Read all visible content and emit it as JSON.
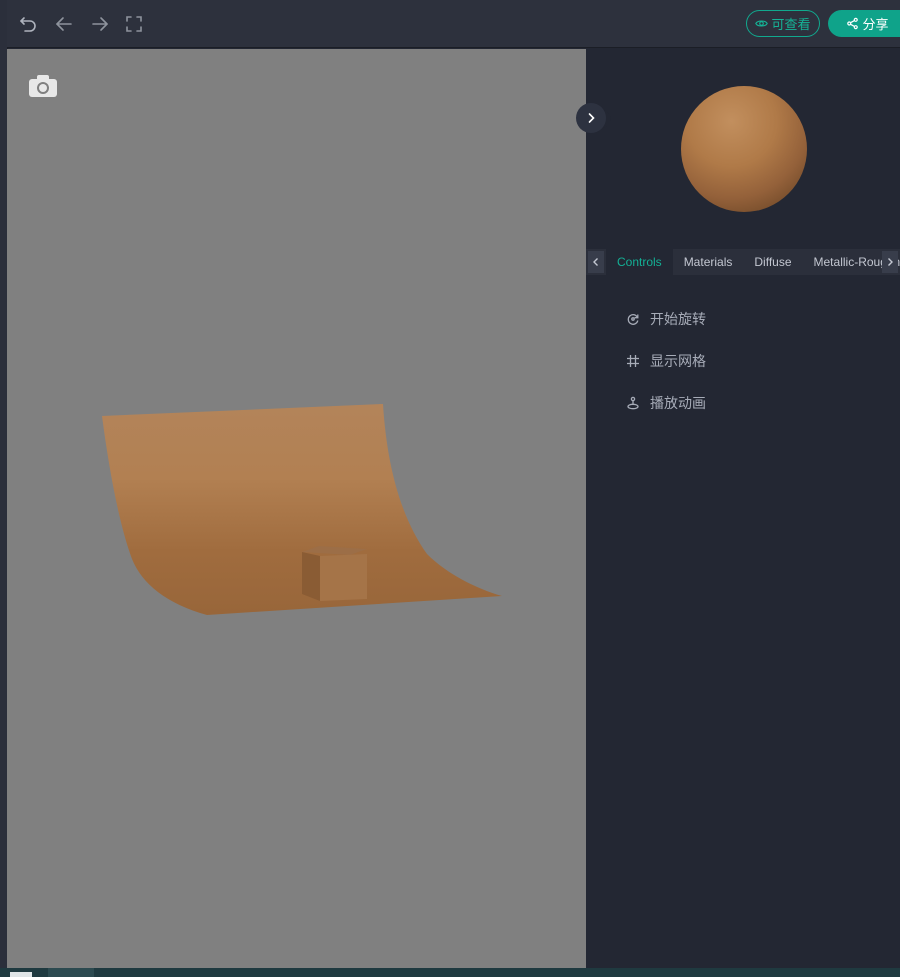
{
  "toolbar": {
    "undo_icon": "undo-icon",
    "back_icon": "arrow-left-icon",
    "forward_icon": "arrow-right-icon",
    "fullscreen_icon": "fullscreen-icon",
    "view_button": {
      "label": "可查看",
      "icon": "eye-icon"
    },
    "share_button": {
      "label": "分享",
      "icon": "share-icon"
    }
  },
  "viewport": {
    "background": "#808080",
    "camera_icon": "camera-icon",
    "model_color": "#a8713f"
  },
  "panel": {
    "collapse_icon": "chevron-right-icon",
    "material_preview_color": "#b07a48",
    "tabs": [
      {
        "label": "Controls",
        "active": true
      },
      {
        "label": "Materials",
        "active": false
      },
      {
        "label": "Diffuse",
        "active": false
      },
      {
        "label": "Metallic-Roughness",
        "active": false
      }
    ],
    "menu": [
      {
        "label": "开始旋转",
        "icon": "rotate-icon"
      },
      {
        "label": "显示网格",
        "icon": "grid-icon"
      },
      {
        "label": "播放动画",
        "icon": "play-animation-icon"
      }
    ]
  },
  "colors": {
    "accent": "#0fa38a",
    "panel_bg": "#232733",
    "topbar_bg": "#2d313d"
  }
}
